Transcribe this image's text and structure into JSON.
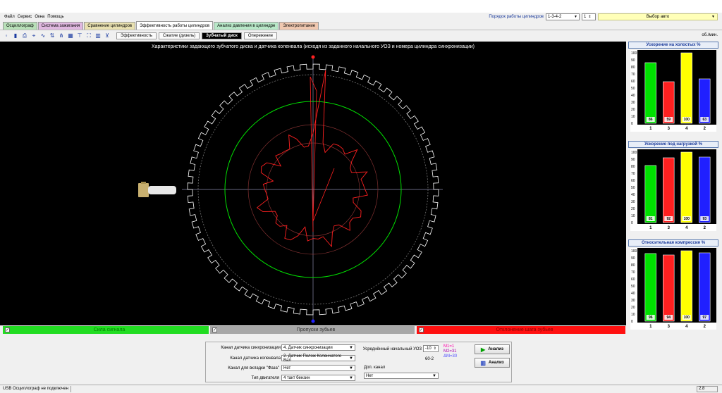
{
  "menu": [
    "Файл",
    "Сервис",
    "Окна",
    "Помощь"
  ],
  "header": {
    "cyl_order_label": "Порядок работы цилиндров",
    "cyl_order_value": "1-3-4-2",
    "cyl_sync_value": "1",
    "car_select": "Выбор авто"
  },
  "tabs": [
    {
      "label": "Осциллограф",
      "color": "#b8e0b8"
    },
    {
      "label": "Система зажигания",
      "color": "#e0b8e0"
    },
    {
      "label": "Сравнение цилиндров",
      "color": "#e8e0b0"
    },
    {
      "label": "Эффективность работы цилиндров",
      "color": "#ffffff",
      "active": true
    },
    {
      "label": "Анализ давления в цилиндре",
      "color": "#b8e8c8"
    },
    {
      "label": "Электропитание",
      "color": "#f0c8b0"
    }
  ],
  "subtabs": [
    {
      "label": "Эффективность"
    },
    {
      "label": "Сжатие (дизель)"
    },
    {
      "label": "Зубчатый диск",
      "active": true
    },
    {
      "label": "Опережение"
    }
  ],
  "rpm_unit": "об./мин.",
  "canvas_title": "Характеристики задающего зубчатого диска и датчика коленвала (исходя из заданного начального УОЗ и номера цилиндра синхронизации)",
  "colors": {
    "green": "#00e000",
    "red": "#ff2020",
    "yellow": "#ffff00",
    "blue": "#2020ff"
  },
  "panels": [
    {
      "title": "Ускорение на холостых %",
      "chart_data": {
        "type": "bar",
        "categories": [
          "1",
          "3",
          "4",
          "2"
        ],
        "values": [
          86,
          59,
          100,
          63
        ],
        "ylim": [
          0,
          100
        ],
        "yticks": [
          "0",
          "10",
          "20",
          "30",
          "40",
          "50",
          "60",
          "70",
          "80",
          "90",
          "100"
        ],
        "colors": [
          "#00e000",
          "#ff2020",
          "#ffff00",
          "#2020ff"
        ]
      }
    },
    {
      "title": "Ускорение под нагрузкой %",
      "chart_data": {
        "type": "bar",
        "categories": [
          "1",
          "3",
          "4",
          "2"
        ],
        "values": [
          81,
          92,
          100,
          93
        ],
        "ylim": [
          0,
          100
        ],
        "yticks": [
          "0",
          "10",
          "20",
          "30",
          "40",
          "50",
          "60",
          "70",
          "80",
          "90",
          "100"
        ],
        "colors": [
          "#00e000",
          "#ff2020",
          "#ffff00",
          "#2020ff"
        ]
      }
    },
    {
      "title": "Относительная компрессия %",
      "chart_data": {
        "type": "bar",
        "categories": [
          "1",
          "3",
          "4",
          "2"
        ],
        "values": [
          96,
          94,
          100,
          97
        ],
        "ylim": [
          0,
          100
        ],
        "yticks": [
          "0",
          "10",
          "20",
          "30",
          "40",
          "50",
          "60",
          "70",
          "80",
          "90",
          "100"
        ],
        "colors": [
          "#00e000",
          "#ff2020",
          "#ffff00",
          "#2020ff"
        ]
      }
    }
  ],
  "legend": [
    {
      "label": "Сила сигнала",
      "color": "#22dd22",
      "text_color": "#008000",
      "checked": "✓"
    },
    {
      "label": "Пропуски зубьев",
      "color": "#a8a8a8",
      "text_color": "#333333",
      "checked": "✓"
    },
    {
      "label": "Отклонение шага зубьев",
      "color": "#ff1010",
      "text_color": "#900000",
      "checked": "✓"
    }
  ],
  "controls": {
    "sync_channel_label": "Канал датчика синхронизации",
    "sync_channel_value": "4. Датчик синхронизации",
    "crank_channel_label": "Канал датчика коленвала",
    "crank_channel_value": "2. Датчик Полож Коленчатого Вал",
    "phase_tab_label": "Канал для вкладки \"Фаза\"",
    "phase_tab_value": "Нет",
    "engine_type_label": "Тип двигателя",
    "engine_type_value": "4 такт бензин",
    "avg_uoz_label": "Усреднённый начальный УОЗ",
    "avg_uoz_value": "-10",
    "teeth_label": "60-2",
    "extra_channel_label": "Доп. канал",
    "extra_channel_value": "Нет",
    "m1": "M1=1",
    "m2": "M2=31",
    "dm": "ΔM=30",
    "analysis_btn_1": "Анализ",
    "analysis_btn_2": "Анализ"
  },
  "status": {
    "text": "USB Осциллограф не подключен",
    "version": "2.8"
  }
}
